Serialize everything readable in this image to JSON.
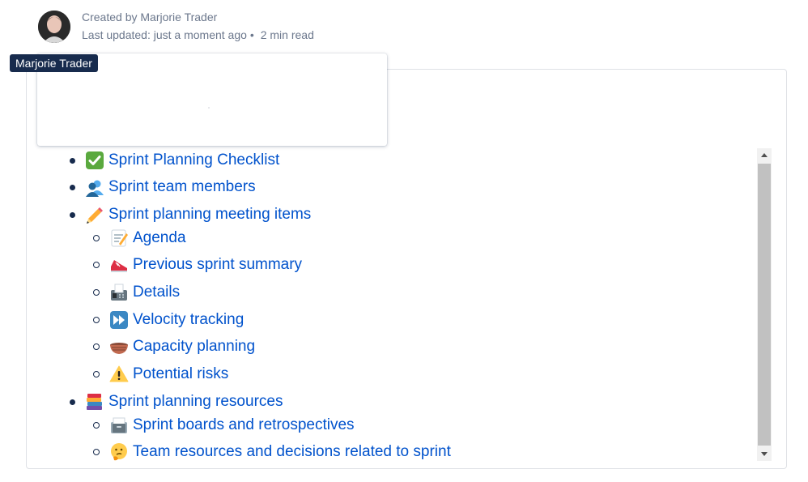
{
  "byline": {
    "created_by": "Created by Marjorie Trader",
    "last_updated": "Last updated: just a moment ago",
    "separator": "•",
    "read_time": "2 min read"
  },
  "tooltip": {
    "name": "Marjorie Trader"
  },
  "toc": {
    "items": [
      {
        "label": "Sprint Planning Checklist",
        "icon": "check-mark-button-icon"
      },
      {
        "label": "Sprint team members",
        "icon": "people-icon"
      },
      {
        "label": "Sprint planning meeting items",
        "icon": "pencil-icon"
      },
      {
        "label": "Agenda",
        "icon": "memo-icon"
      },
      {
        "label": "Previous sprint summary",
        "icon": "running-shoe-icon"
      },
      {
        "label": "Details",
        "icon": "fax-machine-icon"
      },
      {
        "label": "Velocity tracking",
        "icon": "fast-forward-icon"
      },
      {
        "label": "Capacity planning",
        "icon": "basket-icon"
      },
      {
        "label": "Potential risks",
        "icon": "warning-icon"
      },
      {
        "label": "Sprint planning resources",
        "icon": "books-icon"
      },
      {
        "label": "Sprint boards and retrospectives",
        "icon": "card-file-box-icon"
      },
      {
        "label": "Team resources and decisions related to sprint",
        "icon": "thinking-face-icon"
      }
    ]
  },
  "colors": {
    "link": "#0052cc",
    "text": "#172b4d",
    "muted": "#6b778c",
    "tooltip_bg": "#172b4d"
  }
}
